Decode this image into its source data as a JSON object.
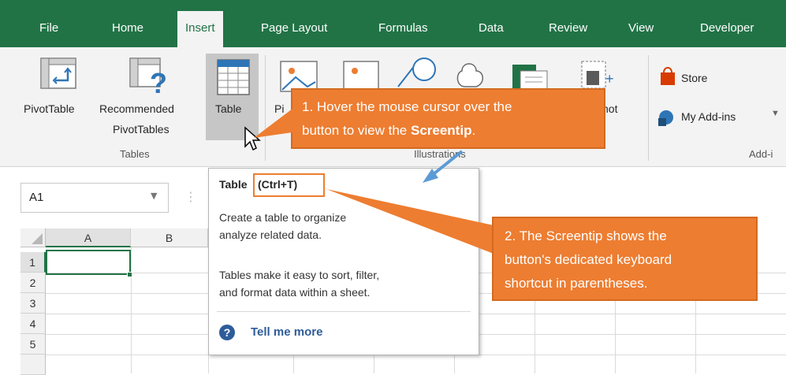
{
  "tabs": [
    "File",
    "Home",
    "Insert",
    "Page Layout",
    "Formulas",
    "Data",
    "Review",
    "View",
    "Developer"
  ],
  "active_tab": "Insert",
  "ribbon": {
    "pivottable": "PivotTable",
    "recommended_line1": "Recommended",
    "recommended_line2": "PivotTables",
    "table": "Table",
    "pictures_partial": "Pi",
    "screenshot_partial": "shot",
    "store": "Store",
    "my_addins": "My Add-ins",
    "group_tables": "Tables",
    "group_illustrations": "Illustrations",
    "group_addins": "Add-i"
  },
  "formula_bar": {
    "name_box": "A1"
  },
  "grid": {
    "columns": [
      "A",
      "B"
    ],
    "rows": [
      "1",
      "2",
      "3",
      "4",
      "5"
    ]
  },
  "screentip": {
    "title": "Table",
    "shortcut": "(Ctrl+T)",
    "desc_line1": "Create a table to organize",
    "desc_line1_tail": "d",
    "desc_line2": "analyze related data.",
    "desc_line3": "Tables make it easy to sort, filter,",
    "desc_line4": "and format data within a sheet.",
    "tell_me_more": "Tell me more"
  },
  "callouts": {
    "one_line1": "1. Hover the mouse cursor over the",
    "one_line2_prefix": "button to view the ",
    "one_line2_bold": "Screentip",
    "one_line2_suffix": ".",
    "two_line1": "2. The Screentip shows the",
    "two_line2": "button's dedicated keyboard",
    "two_line3": "shortcut in parentheses."
  },
  "colors": {
    "excel_green": "#217346",
    "callout_orange": "#ed7d31",
    "arrow_blue": "#5b9bd5",
    "link_blue": "#2e5c9a"
  }
}
